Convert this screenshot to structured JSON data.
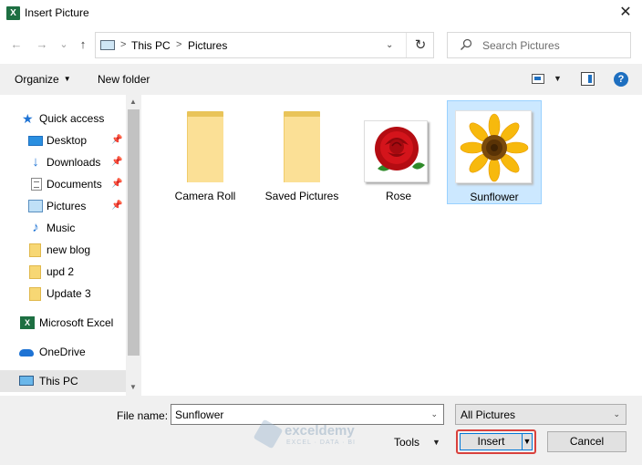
{
  "window": {
    "title": "Insert Picture",
    "app_icon_letter": "X",
    "close_glyph": "✕"
  },
  "nav": {
    "back_glyph": "←",
    "forward_glyph": "→",
    "recent_glyph": "⌄",
    "up_glyph": "↑",
    "breadcrumbs": [
      "This PC",
      "Pictures"
    ],
    "separator": ">",
    "dropdown_glyph": "⌄",
    "refresh_glyph": "↻"
  },
  "search": {
    "placeholder": "Search Pictures"
  },
  "toolbar": {
    "organize_label": "Organize",
    "new_folder_label": "New folder",
    "caret": "▼",
    "help_glyph": "?"
  },
  "sidebar": {
    "pin_glyph": "📌",
    "items": [
      {
        "label": "Quick access",
        "icon": "star-icon"
      },
      {
        "label": "Desktop",
        "icon": "desktop-icon",
        "pinned": true
      },
      {
        "label": "Downloads",
        "icon": "download-icon",
        "pinned": true
      },
      {
        "label": "Documents",
        "icon": "document-icon",
        "pinned": true
      },
      {
        "label": "Pictures",
        "icon": "pictures-icon",
        "pinned": true
      },
      {
        "label": "Music",
        "icon": "music-icon"
      },
      {
        "label": "new blog",
        "icon": "folder-icon"
      },
      {
        "label": "upd 2",
        "icon": "folder-icon"
      },
      {
        "label": "Update 3",
        "icon": "folder-icon"
      },
      {
        "label": "Microsoft Excel",
        "icon": "excel-icon"
      },
      {
        "label": "OneDrive",
        "icon": "onedrive-icon"
      },
      {
        "label": "This PC",
        "icon": "pc-icon",
        "selected": true
      }
    ],
    "scroll_up_glyph": "▲",
    "scroll_down_glyph": "▼"
  },
  "files": [
    {
      "name": "Camera Roll",
      "kind": "folder"
    },
    {
      "name": "Saved Pictures",
      "kind": "folder"
    },
    {
      "name": "Rose",
      "kind": "image"
    },
    {
      "name": "Sunflower",
      "kind": "image",
      "selected": true
    }
  ],
  "footer": {
    "file_name_label": "File name:",
    "file_name_value": "Sunflower",
    "filter_value": "All Pictures",
    "tools_label": "Tools",
    "insert_label": "Insert",
    "cancel_label": "Cancel",
    "caret": "▼"
  },
  "watermark": {
    "name": "exceldemy",
    "tagline": "EXCEL · DATA · BI"
  },
  "colors": {
    "accent": "#0078d7",
    "selection": "#cce8ff",
    "highlight_border": "#d9413d",
    "folder": "#fbe096"
  }
}
